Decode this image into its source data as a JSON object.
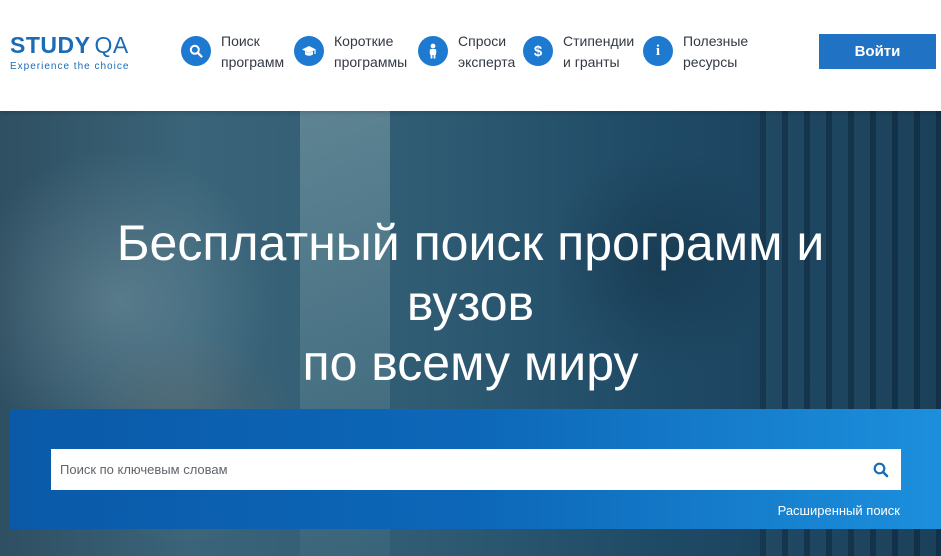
{
  "logo": {
    "main": "STUDY",
    "qa": "QA",
    "tagline": "Experience the choice"
  },
  "nav": [
    {
      "label": "Поиск программ",
      "icon": "search-icon"
    },
    {
      "label": "Короткие программы",
      "icon": "graduation-cap-icon"
    },
    {
      "label": "Спроси эксперта",
      "icon": "person-icon"
    },
    {
      "label": "Стипендии и гранты",
      "icon": "dollar-icon"
    },
    {
      "label": "Полезные ресурсы",
      "icon": "info-icon"
    }
  ],
  "login_label": "Войти",
  "hero": {
    "line1": "Бесплатный поиск программ и",
    "line2": "вузов",
    "line3": "по всему миру"
  },
  "search": {
    "placeholder": "Поиск по ключевым словам",
    "advanced_label": "Расширенный поиск"
  },
  "colors": {
    "brand": "#1b6bb5",
    "accent": "#1d7ad0",
    "panel": "#0d67b8"
  }
}
